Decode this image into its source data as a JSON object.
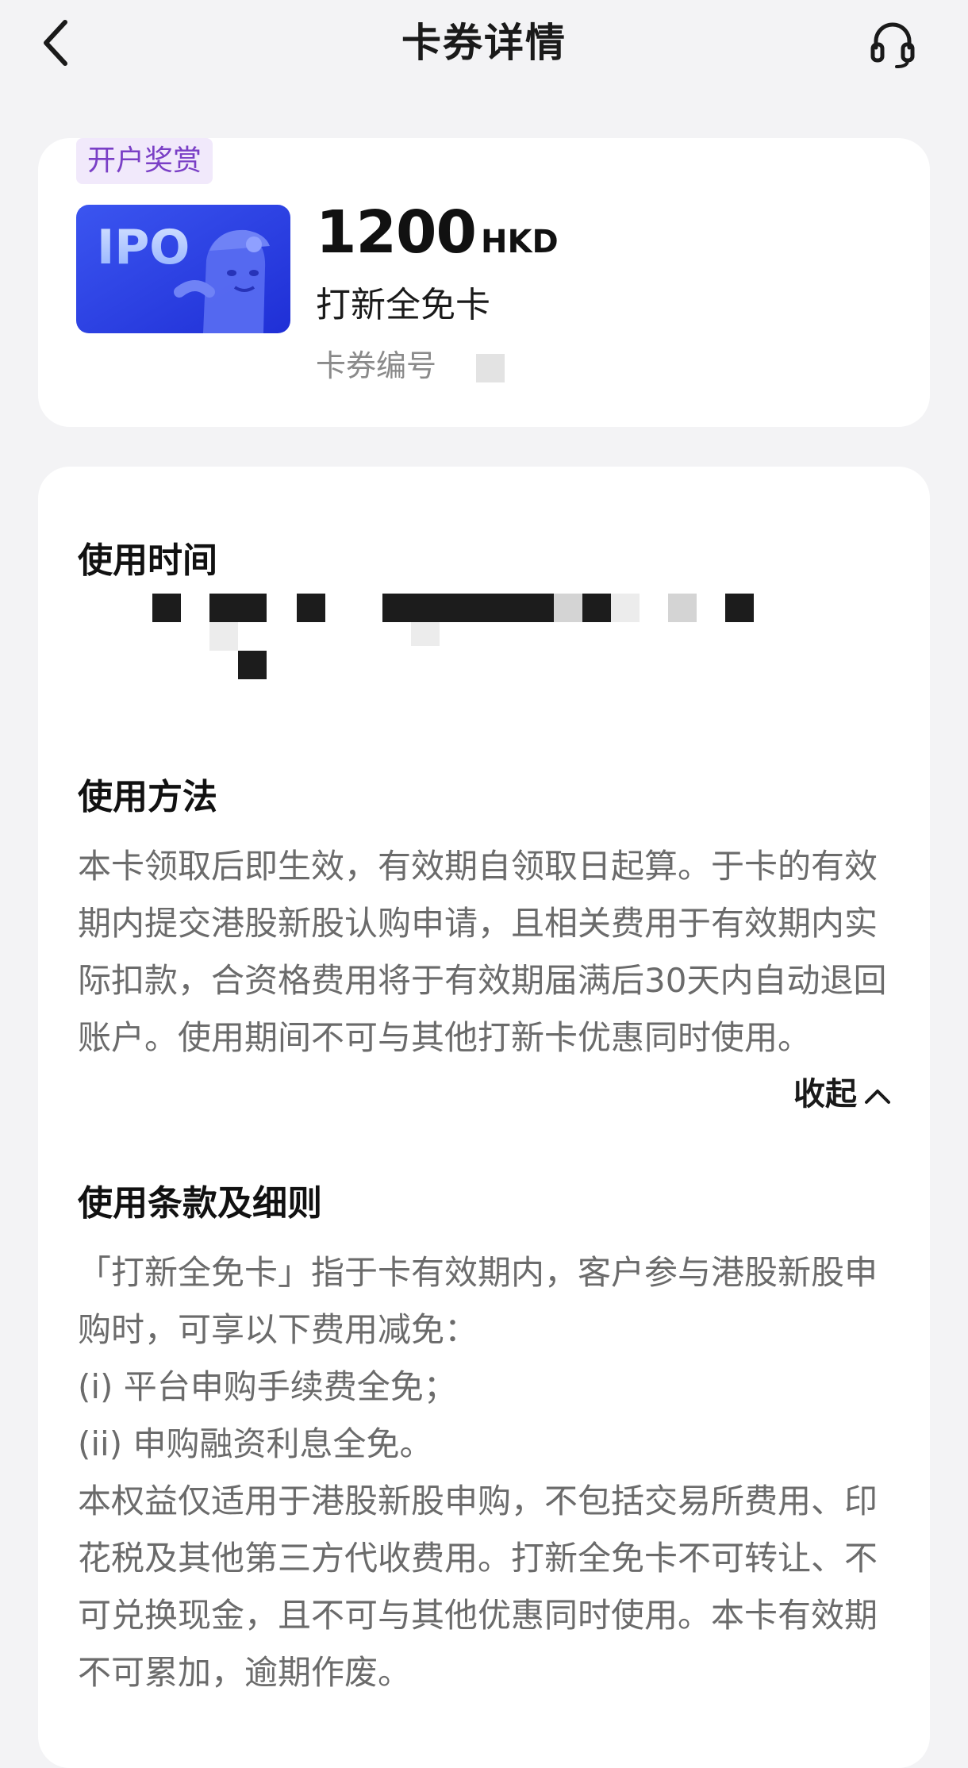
{
  "header": {
    "title": "卡券详情"
  },
  "coupon": {
    "tag": "开户奖赏",
    "image_text": "IPO",
    "amount": "1200",
    "currency": "HKD",
    "name": "打新全免卡",
    "number_label": "卡券编号"
  },
  "sections": {
    "time": {
      "title": "使用时间"
    },
    "method": {
      "title": "使用方法",
      "text": "本卡领取后即生效，有效期自领取日起算。于卡的有效期内提交港股新股认购申请，且相关费用于有效期内实际扣款，合资格费用将于有效期届满后30天内自动退回账户。使用期间不可与其他打新卡优惠同时使用。",
      "collapse_label": "收起"
    },
    "terms": {
      "title": "使用条款及细则",
      "lines": [
        "「打新全免卡」指于卡有效期内，客户参与港股新股申购时，可享以下费用减免：",
        "(i) 平台申购手续费全免；",
        "(ii) 申购融资利息全免。",
        "本权益仅适用于港股新股申购，不包括交易所费用、印花税及其他第三方代收费用。打新全免卡不可转让、不可兑换现金，且不可与其他优惠同时使用。本卡有效期不可累加，逾期作废。"
      ]
    }
  },
  "colors": {
    "background": "#f3f3f5",
    "card": "#ffffff",
    "tag_bg": "#f1e9fb",
    "tag_text": "#7a3fc6",
    "ipo_blue": "#2f3fe0",
    "body_text": "#6b6b6b"
  },
  "icons": {
    "back": "chevron-left-icon",
    "support": "headset-icon",
    "collapse": "chevron-up-icon"
  }
}
